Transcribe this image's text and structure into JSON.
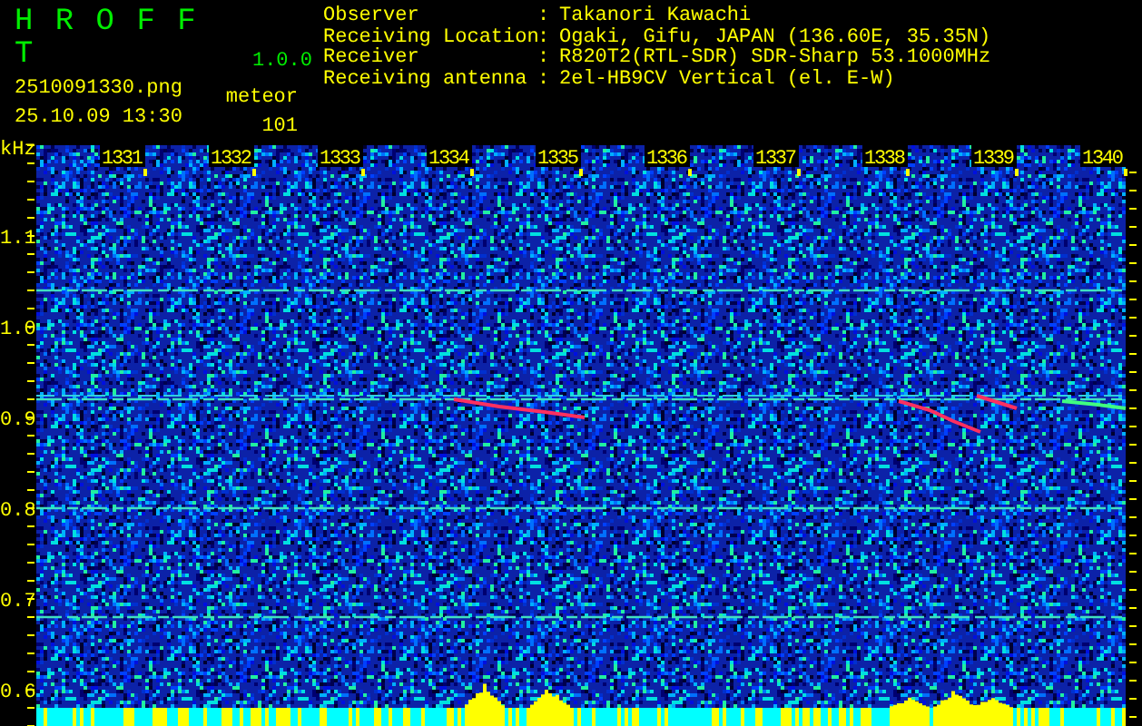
{
  "app": {
    "name": "H R O F F T",
    "version": "1.0.0"
  },
  "file": {
    "name": "2510091330.png",
    "datetime": "25.10.09 13:30"
  },
  "counter": {
    "label": "meteor",
    "value": "101"
  },
  "station": [
    {
      "label": "Observer",
      "separator": ":",
      "value": "Takanori Kawachi"
    },
    {
      "label": "Receiving Location",
      "separator": ":",
      "value": "Ogaki, Gifu, JAPAN (136.60E, 35.35N)"
    },
    {
      "label": "Receiver",
      "separator": ":",
      "value": "R820T2(RTL-SDR) SDR-Sharp 53.1000MHz"
    },
    {
      "label": "Receiving antenna",
      "separator": ":",
      "value": "2el-HB9CV Vertical (el. E-W)"
    }
  ],
  "spectrogram": {
    "frequency_unit": "kHz",
    "frequency_labels": [
      "1.1",
      "1.0",
      "0.9",
      "0.8",
      "0.7",
      "0.6"
    ],
    "time_labels": [
      "1331",
      "1332",
      "1333",
      "1334",
      "1335",
      "1336",
      "1337",
      "1338",
      "1339",
      "1340"
    ]
  }
}
